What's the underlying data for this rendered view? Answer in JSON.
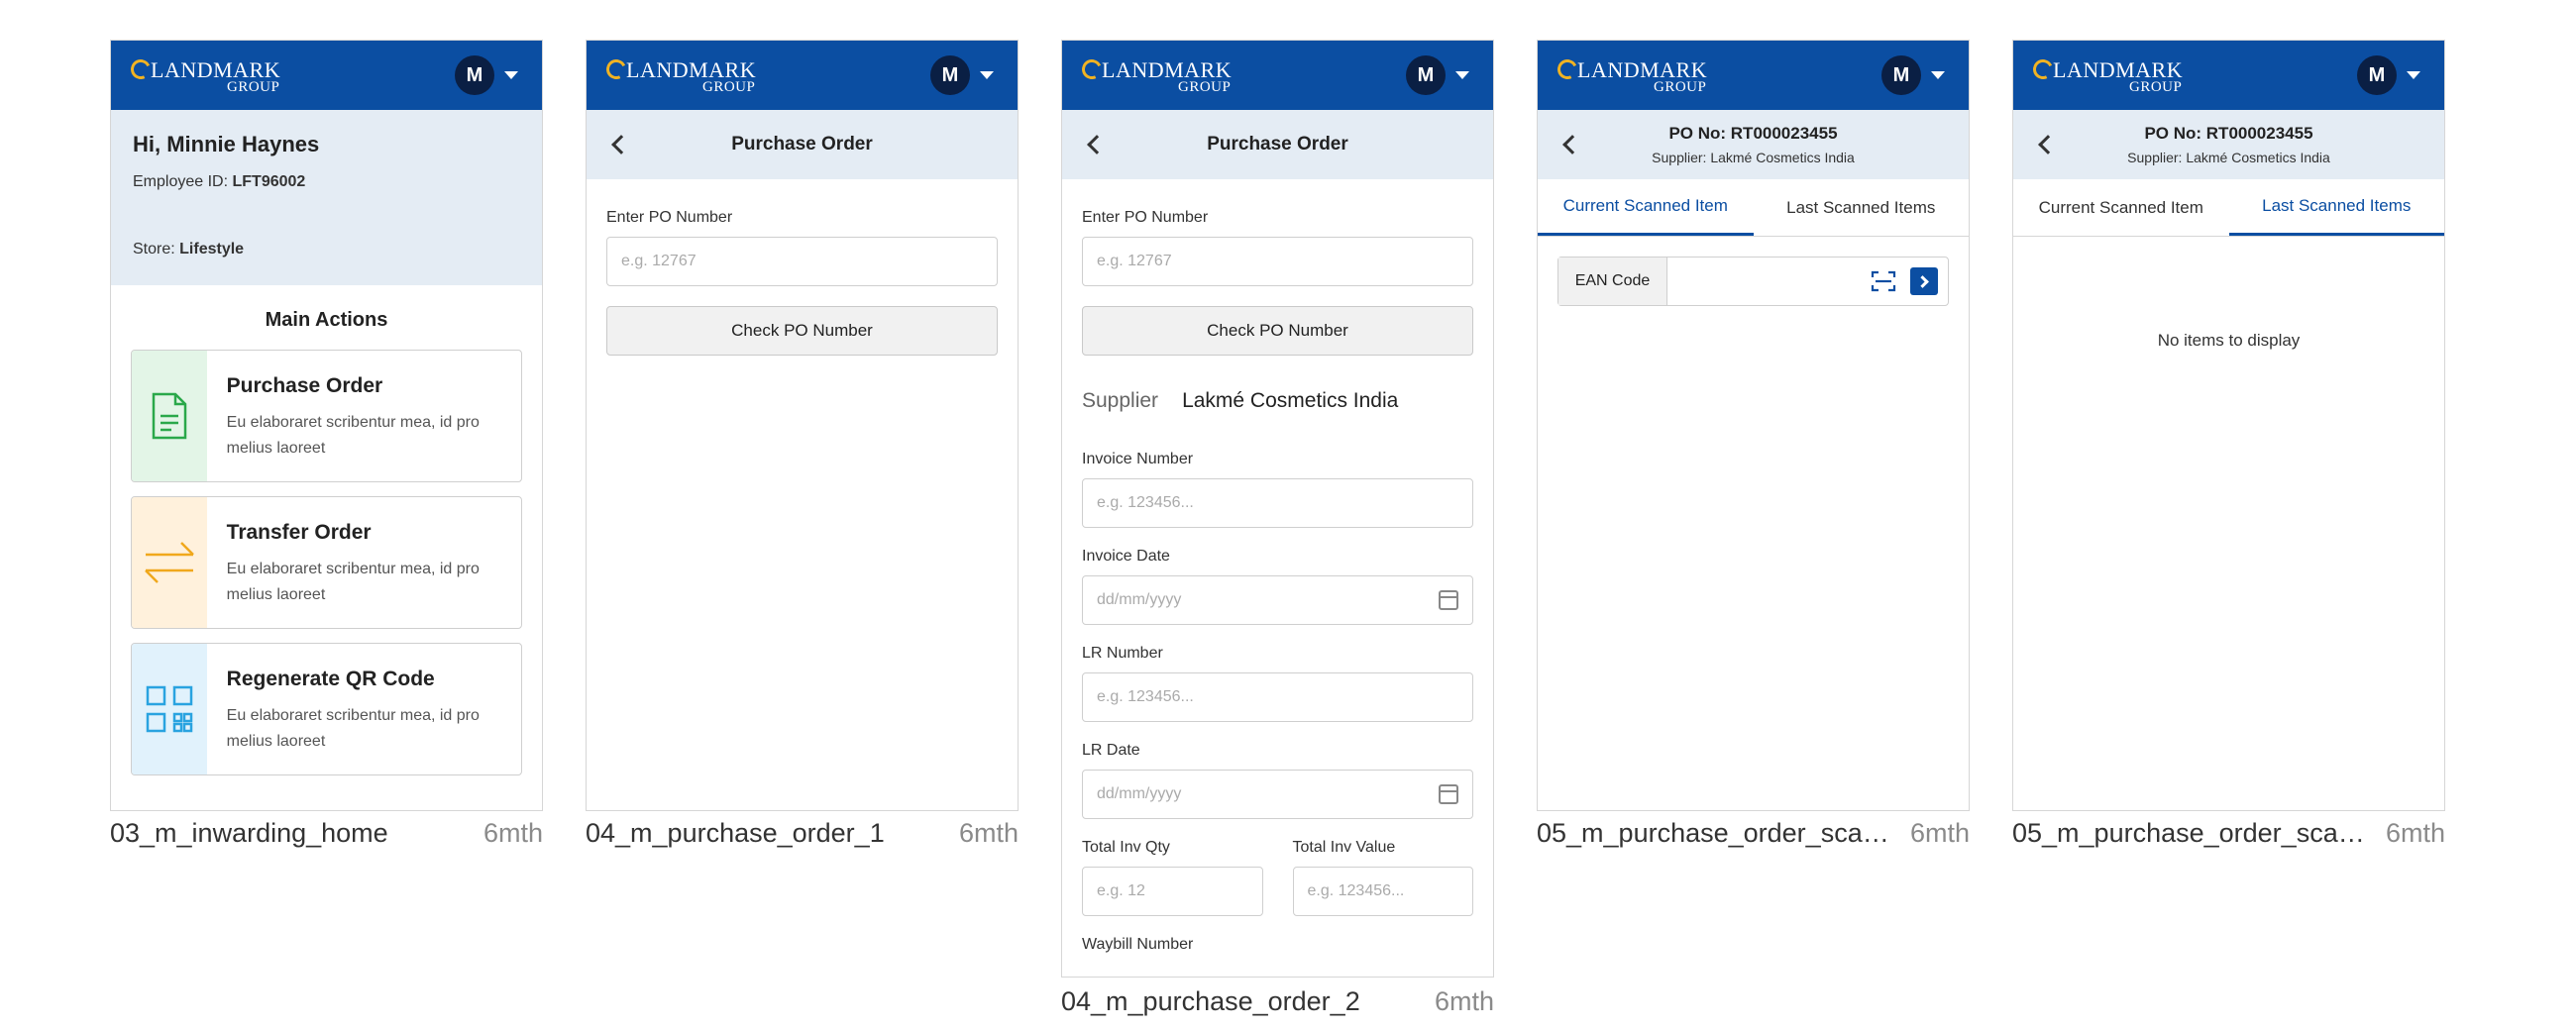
{
  "header": {
    "brand": "LANDMARK",
    "group": "GROUP",
    "avatar": "M"
  },
  "screens": [
    {
      "caption": "03_m_inwarding_home",
      "age": "6mth",
      "greeting": "Hi, Minnie Haynes",
      "employee_label": "Employee ID:",
      "employee_id": "LFT96002",
      "store_label": "Store:",
      "store": "Lifestyle",
      "main_actions": "Main Actions",
      "cards": [
        {
          "title": "Purchase Order",
          "desc": "Eu elaboraret scribentur mea, id pro melius laoreet",
          "icon": "document-icon",
          "bg": "#e3f5e7",
          "color": "#2aa84a"
        },
        {
          "title": "Transfer Order",
          "desc": "Eu elaboraret scribentur mea, id pro melius laoreet",
          "icon": "transfer-arrows-icon",
          "bg": "#fff1dc",
          "color": "#f0a81c"
        },
        {
          "title": "Regenerate QR Code",
          "desc": "Eu elaboraret scribentur mea, id pro melius laoreet",
          "icon": "qr-code-icon",
          "bg": "#e1f2fc",
          "color": "#29a3e0"
        }
      ]
    },
    {
      "caption": "04_m_purchase_order_1",
      "age": "6mth",
      "title": "Purchase Order",
      "po_label": "Enter PO Number",
      "po_placeholder": "e.g. 12767",
      "check_button": "Check PO Number"
    },
    {
      "caption": "04_m_purchase_order_2",
      "age": "6mth",
      "title": "Purchase Order",
      "po_label": "Enter PO Number",
      "po_placeholder": "e.g. 12767",
      "check_button": "Check PO Number",
      "supplier_label": "Supplier",
      "supplier": "Lakmé Cosmetics India",
      "invoice_number_label": "Invoice Number",
      "invoice_number_placeholder": "e.g. 123456...",
      "invoice_date_label": "Invoice Date",
      "invoice_date_placeholder": "dd/mm/yyyy",
      "lr_number_label": "LR Number",
      "lr_number_placeholder": "e.g. 123456...",
      "lr_date_label": "LR Date",
      "lr_date_placeholder": "dd/mm/yyyy",
      "total_qty_label": "Total Inv Qty",
      "total_qty_placeholder": "e.g. 12",
      "total_value_label": "Total Inv Value",
      "total_value_placeholder": "e.g. 123456...",
      "waybill_label": "Waybill Number"
    },
    {
      "caption": "05_m_purchase_order_scan...",
      "age": "6mth",
      "po_no": "PO No: RT000023455",
      "supplier": "Supplier: Lakmé Cosmetics India",
      "tabs": [
        "Current Scanned Item",
        "Last Scanned Items"
      ],
      "ean_label": "EAN Code"
    },
    {
      "caption": "05_m_purchase_order_scan...",
      "age": "6mth",
      "po_no": "PO No: RT000023455",
      "supplier": "Supplier: Lakmé Cosmetics India",
      "tabs": [
        "Current Scanned Item",
        "Last Scanned Items"
      ],
      "empty": "No items to display"
    }
  ],
  "colors": {
    "primary": "#0b4ea2",
    "subheader": "#e4ecf4"
  }
}
